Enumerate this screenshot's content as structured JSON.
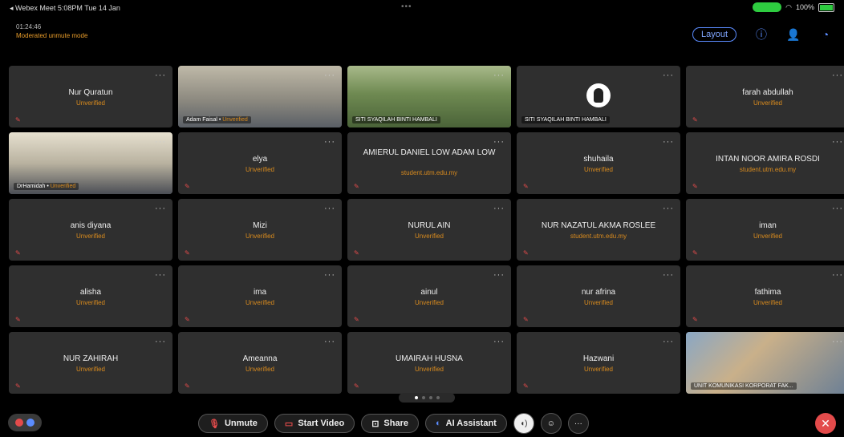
{
  "status": {
    "left": "◂ Webex Meet  5:08PM  Tue 14 Jan",
    "center": "•••",
    "battery": "100%"
  },
  "meeting": {
    "timer": "01:24:46",
    "mode": "Moderated unmute mode",
    "layout_label": "Layout"
  },
  "tiles": [
    {
      "name": "Nur Quratun",
      "sub": "Unverified"
    },
    {
      "video": true,
      "caption_name": "Adam Faisal",
      "caption_sub": "Unverified"
    },
    {
      "video": true,
      "caption_name": "SITI SYAQILAH BINTI HAMBALI",
      "caption_sub": ""
    },
    {
      "avatar": true,
      "caption_name": "SITI SYAQILAH BINTI HAMBALI",
      "caption_sub": ""
    },
    {
      "name": "farah abdullah",
      "sub": "Unverified"
    },
    {
      "video": true,
      "caption_name": "DrHamidah",
      "caption_sub": "Unverified"
    },
    {
      "name": "elya",
      "sub": "Unverified"
    },
    {
      "name": "AMIERUL DANIEL LOW ADAM LOW",
      "sub": "student.utm.edu.my",
      "tall": true
    },
    {
      "name": "shuhaila",
      "sub": "Unverified"
    },
    {
      "name": "INTAN NOOR AMIRA ROSDI",
      "sub": "student.utm.edu.my"
    },
    {
      "name": "anis diyana",
      "sub": "Unverified"
    },
    {
      "name": "Mizi",
      "sub": "Unverified"
    },
    {
      "name": "NURUL AIN",
      "sub": "Unverified"
    },
    {
      "name": "NUR NAZATUL AKMA ROSLEE",
      "sub": "student.utm.edu.my"
    },
    {
      "name": "iman",
      "sub": "Unverified"
    },
    {
      "name": "alisha",
      "sub": "Unverified"
    },
    {
      "name": "ima",
      "sub": "Unverified"
    },
    {
      "name": "ainul",
      "sub": "Unverified"
    },
    {
      "name": "nur afrina",
      "sub": "Unverified"
    },
    {
      "name": "fathima",
      "sub": "Unverified"
    },
    {
      "name": "NUR ZAHIRAH",
      "sub": "Unverified"
    },
    {
      "name": "Ameanna",
      "sub": "Unverified"
    },
    {
      "name": "UMAIRAH HUSNA",
      "sub": "Unverified"
    },
    {
      "name": "Hazwani",
      "sub": "Unverified"
    },
    {
      "video": true,
      "caption_name": "UNIT KOMUNIKASI KORPORAT FAK...",
      "caption_sub": ""
    }
  ],
  "controls": {
    "unmute": "Unmute",
    "start_video": "Start Video",
    "share": "Share",
    "ai_assistant": "AI Assistant"
  },
  "colors": {
    "accent": "#5b8cff",
    "unverified": "#d98b1e",
    "danger": "#e34b4b",
    "tile_bg": "#2f2f2f"
  }
}
